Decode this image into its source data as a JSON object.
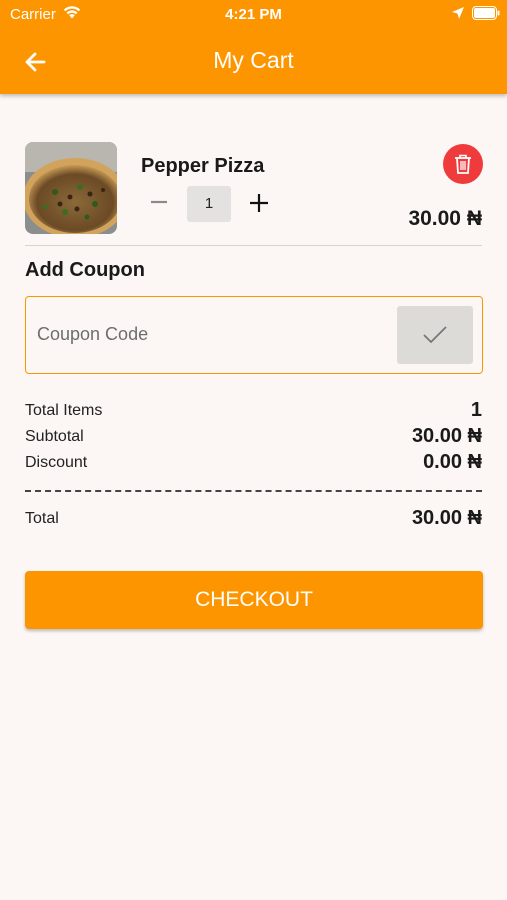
{
  "status_bar": {
    "carrier": "Carrier",
    "time": "4:21 PM"
  },
  "header": {
    "title": "My Cart",
    "back_icon": "arrow-left-icon"
  },
  "cart": {
    "items": [
      {
        "name": "Pepper Pizza",
        "quantity": "1",
        "price": "30.00 ₦",
        "image": "pizza-image"
      }
    ]
  },
  "coupon": {
    "title": "Add Coupon",
    "placeholder": "Coupon Code",
    "value": ""
  },
  "summary": {
    "total_items_label": "Total Items",
    "total_items_value": "1",
    "subtotal_label": "Subtotal",
    "subtotal_value": "30.00 ₦",
    "discount_label": "Discount",
    "discount_value": "0.00 ₦",
    "total_label": "Total",
    "total_value": "30.00 ₦"
  },
  "checkout": {
    "label": "CHECKOUT"
  },
  "colors": {
    "primary": "#fd9500",
    "delete": "#ef3b3b",
    "background": "#fcf7f4"
  }
}
